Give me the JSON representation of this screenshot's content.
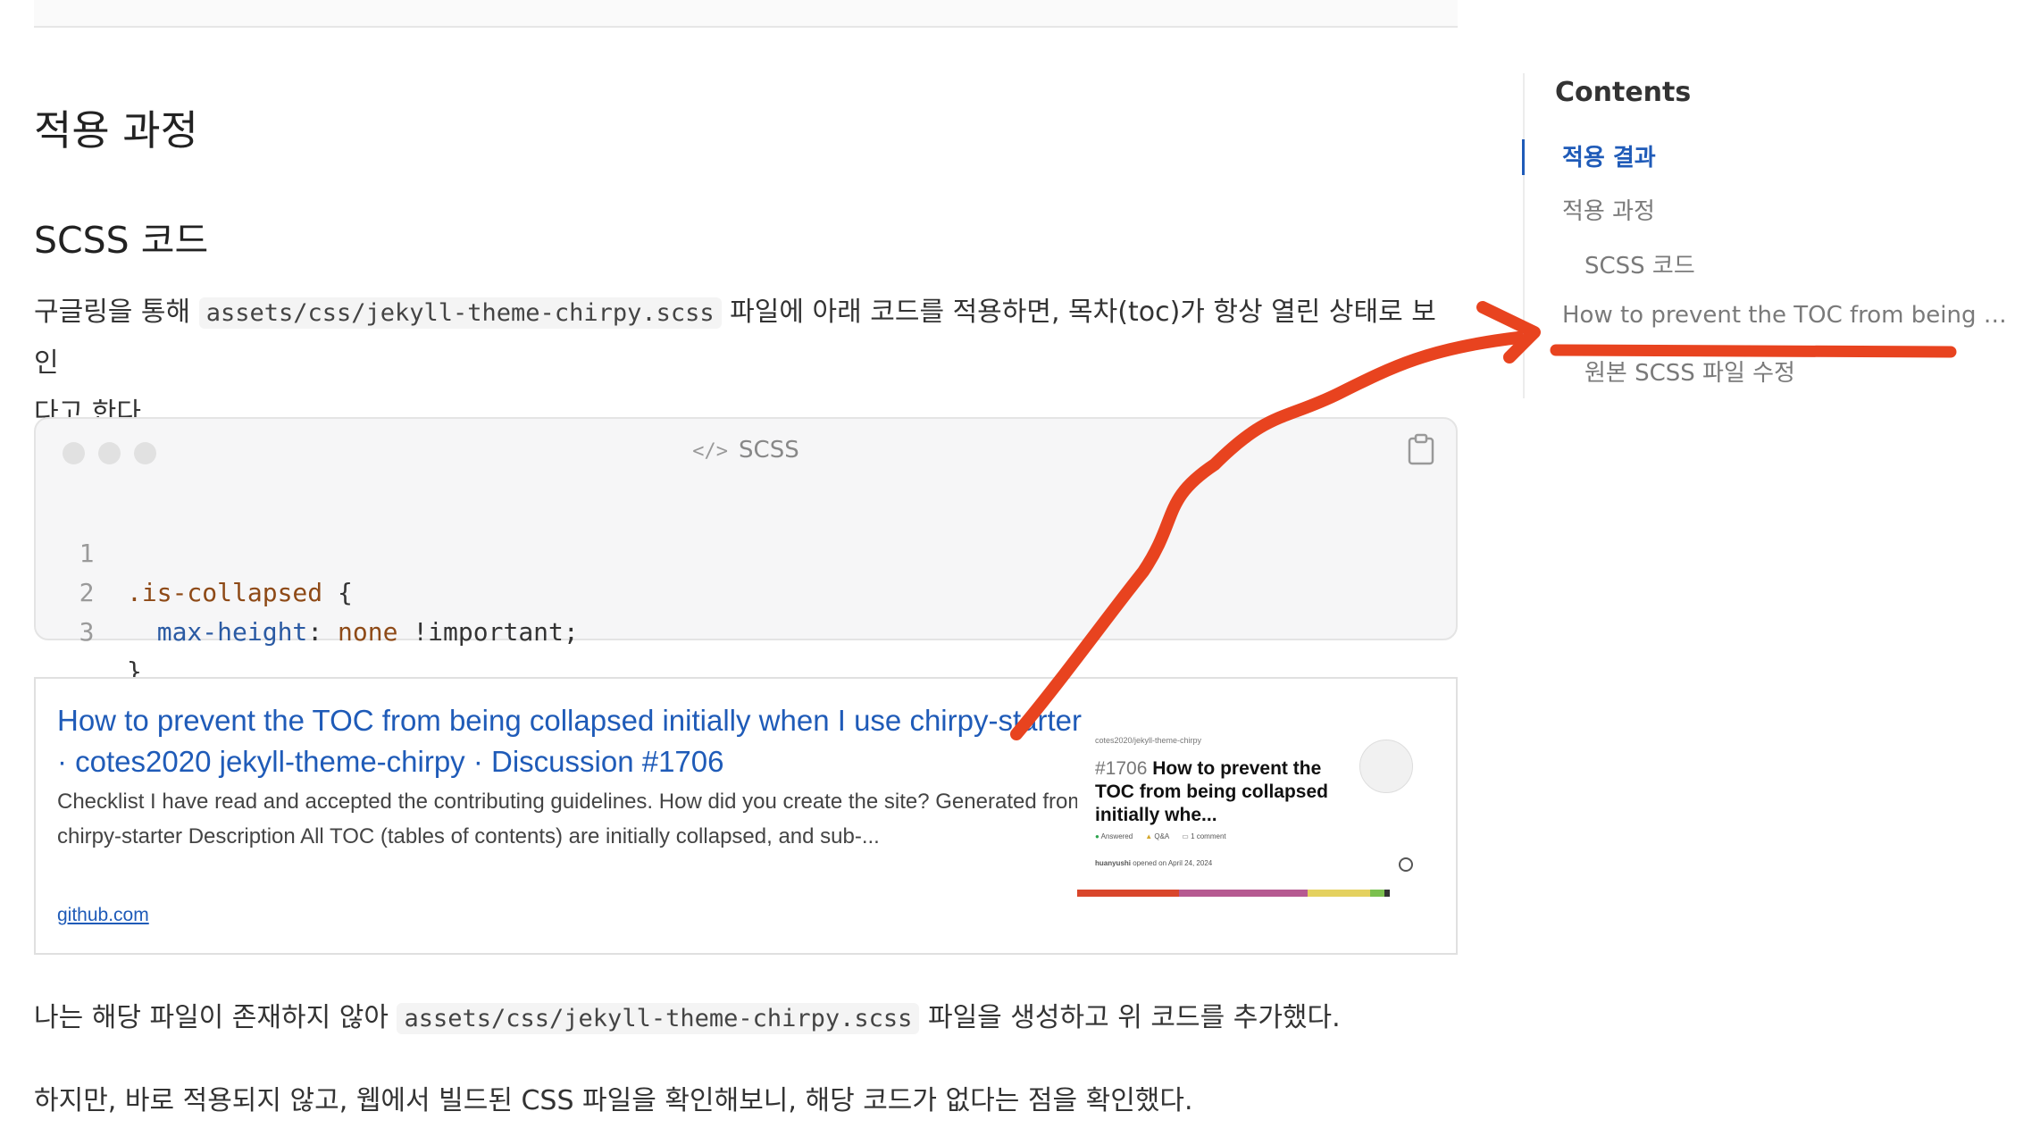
{
  "article": {
    "h2": "적용 과정",
    "h3": "SCSS 코드",
    "p1_before": "구글링을 통해 ",
    "p1_code": "assets/css/jekyll-theme-chirpy.scss",
    "p1_after": " 파일에 아래 코드를 적용하면, 목차(toc)가 항상 열린 상태로 보인",
    "p1_line2": "다고 한다.",
    "p2_before": "나는 해당 파일이 존재하지 않아 ",
    "p2_code": "assets/css/jekyll-theme-chirpy.scss",
    "p2_after": " 파일을 생성하고 위 코드를 추가했다.",
    "p3": "하지만, 바로 적용되지 않고, 웹에서 빌드된 CSS 파일을 확인해보니, 해당 코드가 없다는 점을 확인했다."
  },
  "codeblock": {
    "lang_icon": "</>",
    "lang": "SCSS",
    "copy_icon": "clipboard-icon",
    "lines": [
      {
        "num": "1",
        "sel": ".is-collapsed",
        "rest": " {"
      },
      {
        "num": "2",
        "prop": "max-height",
        "colon": ": ",
        "val": "none",
        "imp": " !important;"
      },
      {
        "num": "3",
        "rest": "}"
      }
    ]
  },
  "linkcard": {
    "title": "How to prevent the TOC from being collapsed initially when I use chirpy-starter · cotes2020 jekyll-theme-chirpy · Discussion #1706",
    "description": "Checklist I have read and accepted the contributing guidelines. How did you create the site? Generated from chirpy-starter Description All TOC (tables of contents) are initially collapsed, and sub-...",
    "url": "github.com",
    "thumb": {
      "repo": "cotes2020/jekyll-theme-chirpy",
      "number": "#1706",
      "title": "How to prevent the TOC from being collapsed initially whe...",
      "meta": [
        "Answered",
        "Q&A",
        "1 comment"
      ],
      "user": "huanyushi",
      "opened": "opened on April 24, 2024",
      "bar_colors": [
        "#d9462b",
        "#b65a91",
        "#e4d15f",
        "#7cc04f",
        "#333333"
      ]
    }
  },
  "toc": {
    "heading": "Contents",
    "items": [
      {
        "label": "적용 결과",
        "level": 1,
        "active": true
      },
      {
        "label": "적용 과정",
        "level": 1,
        "active": false
      },
      {
        "label": "SCSS 코드",
        "level": 2,
        "active": false
      },
      {
        "label": "How to prevent the TOC from being …",
        "level": 1,
        "active": false
      },
      {
        "label": "원본 SCSS 파일 수정",
        "level": 2,
        "active": false
      }
    ]
  },
  "annotation": {
    "color": "#e8431f"
  }
}
